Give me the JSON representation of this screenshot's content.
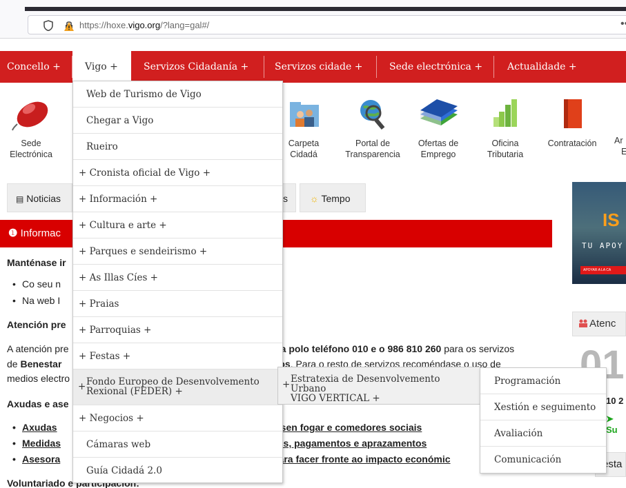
{
  "browser": {
    "url_prefix": "https://hoxe.",
    "url_domain": "vigo.org",
    "url_suffix": "/?lang=gal#/",
    "more": "••"
  },
  "nav": {
    "items": [
      "Concello +",
      "Vigo +",
      "Servizos Cidadanía +",
      "Servizos cidade +",
      "Sede electrónica +",
      "Actualidade +"
    ]
  },
  "icons": {
    "sede": [
      "Sede",
      "Electrónica"
    ],
    "carpeta": [
      "Carpeta",
      "Cidadá"
    ],
    "portal": [
      "Portal de",
      "Transparencia"
    ],
    "ofertas": [
      "Ofertas de",
      "Emprego"
    ],
    "oficina": [
      "Oficina",
      "Tributaria"
    ],
    "contratacion": "Contratación",
    "partial_top": "Ar",
    "partial_bottom": "E"
  },
  "tabs": {
    "noticias": "Noticias",
    "partial": "s",
    "tempo": "Tempo"
  },
  "content": {
    "info_title": "Informac",
    "heading1": "Manténase ir",
    "bullet1": "Co seu n",
    "bullet2": "Na web I",
    "heading2": "Atención pre",
    "para_left1": "A atención pre",
    "para_right1_bold": "via polo teléfono 010 e o 986 810 260",
    "para_right1_rest": " para os servizos",
    "para_left2_a": "de ",
    "para_left2_b": "Benestar",
    "para_right2_bold": "rios",
    "para_right2_rest": ". Para o resto de servizos recoméndase o uso de",
    "para_left3": "medios electro",
    "heading3": "Axudas e ase",
    "link1_left": "Axudas",
    "link1_right": "s sen fogar e comedores sociais",
    "link2_left": "Medidas",
    "link2_right": "zos, pagamentos e aprazamentos",
    "link3_left": "Asesora",
    "link3_right": " para facer fronte ao impacto económic",
    "heading4": "Voluntariado e participación:"
  },
  "side": {
    "banner_title": "IS",
    "banner_sub": "TU APOY",
    "banner_btn": "APOYAR A LA CA",
    "aten": "Atenc",
    "bignum": "01",
    "small1": "10 2",
    "small2": "Su",
    "box2": "esta"
  },
  "dropdown": {
    "items": [
      "Web de Turismo de Vigo",
      "Chegar a Vigo",
      "Rueiro",
      "+ Cronista oficial de Vigo +",
      "+ Información +",
      "+ Cultura e arte +",
      "+ Parques e sendeirismo +",
      "+ As Illas Cíes +",
      "+ Praias",
      "+ Parroquias +",
      "+ Festas +",
      "Fondo Europeo de Desenvolvemento",
      "+ Negocios +",
      "Cámaras web",
      "Guía Cidadá 2.0"
    ],
    "feder_line2": "Rexional (FEDER) +",
    "sub1_line1": "Estratexia de Desenvolvemento Urbano",
    "sub1_line2": "VIGO VERTICAL +",
    "sub2_items": [
      "Programación",
      "Xestión e seguimento",
      "Avaliación",
      "Comunicación"
    ]
  },
  "colors": {
    "nav_red": "#d11f1f",
    "info_red": "#d80000"
  }
}
